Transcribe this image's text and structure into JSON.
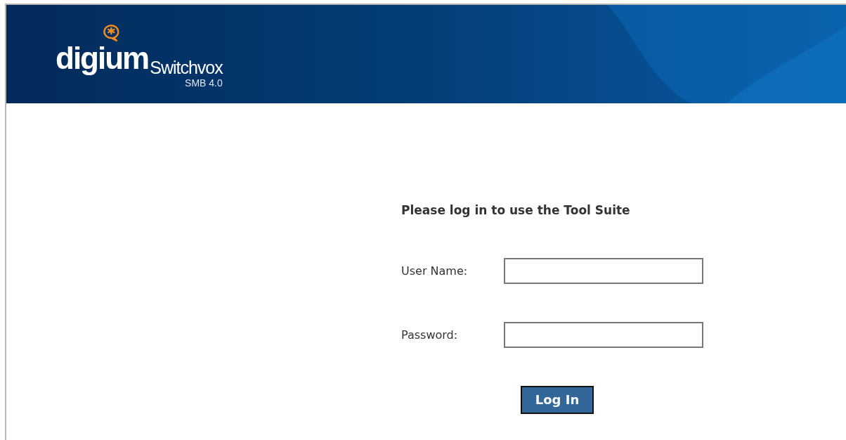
{
  "header": {
    "brand": "digium",
    "product": "Switchvox",
    "edition": "SMB 4.0"
  },
  "login": {
    "heading": "Please log in to use the Tool Suite",
    "fields": [
      {
        "label": "User Name:"
      },
      {
        "label": "Password:"
      }
    ],
    "button": "Log In"
  }
}
